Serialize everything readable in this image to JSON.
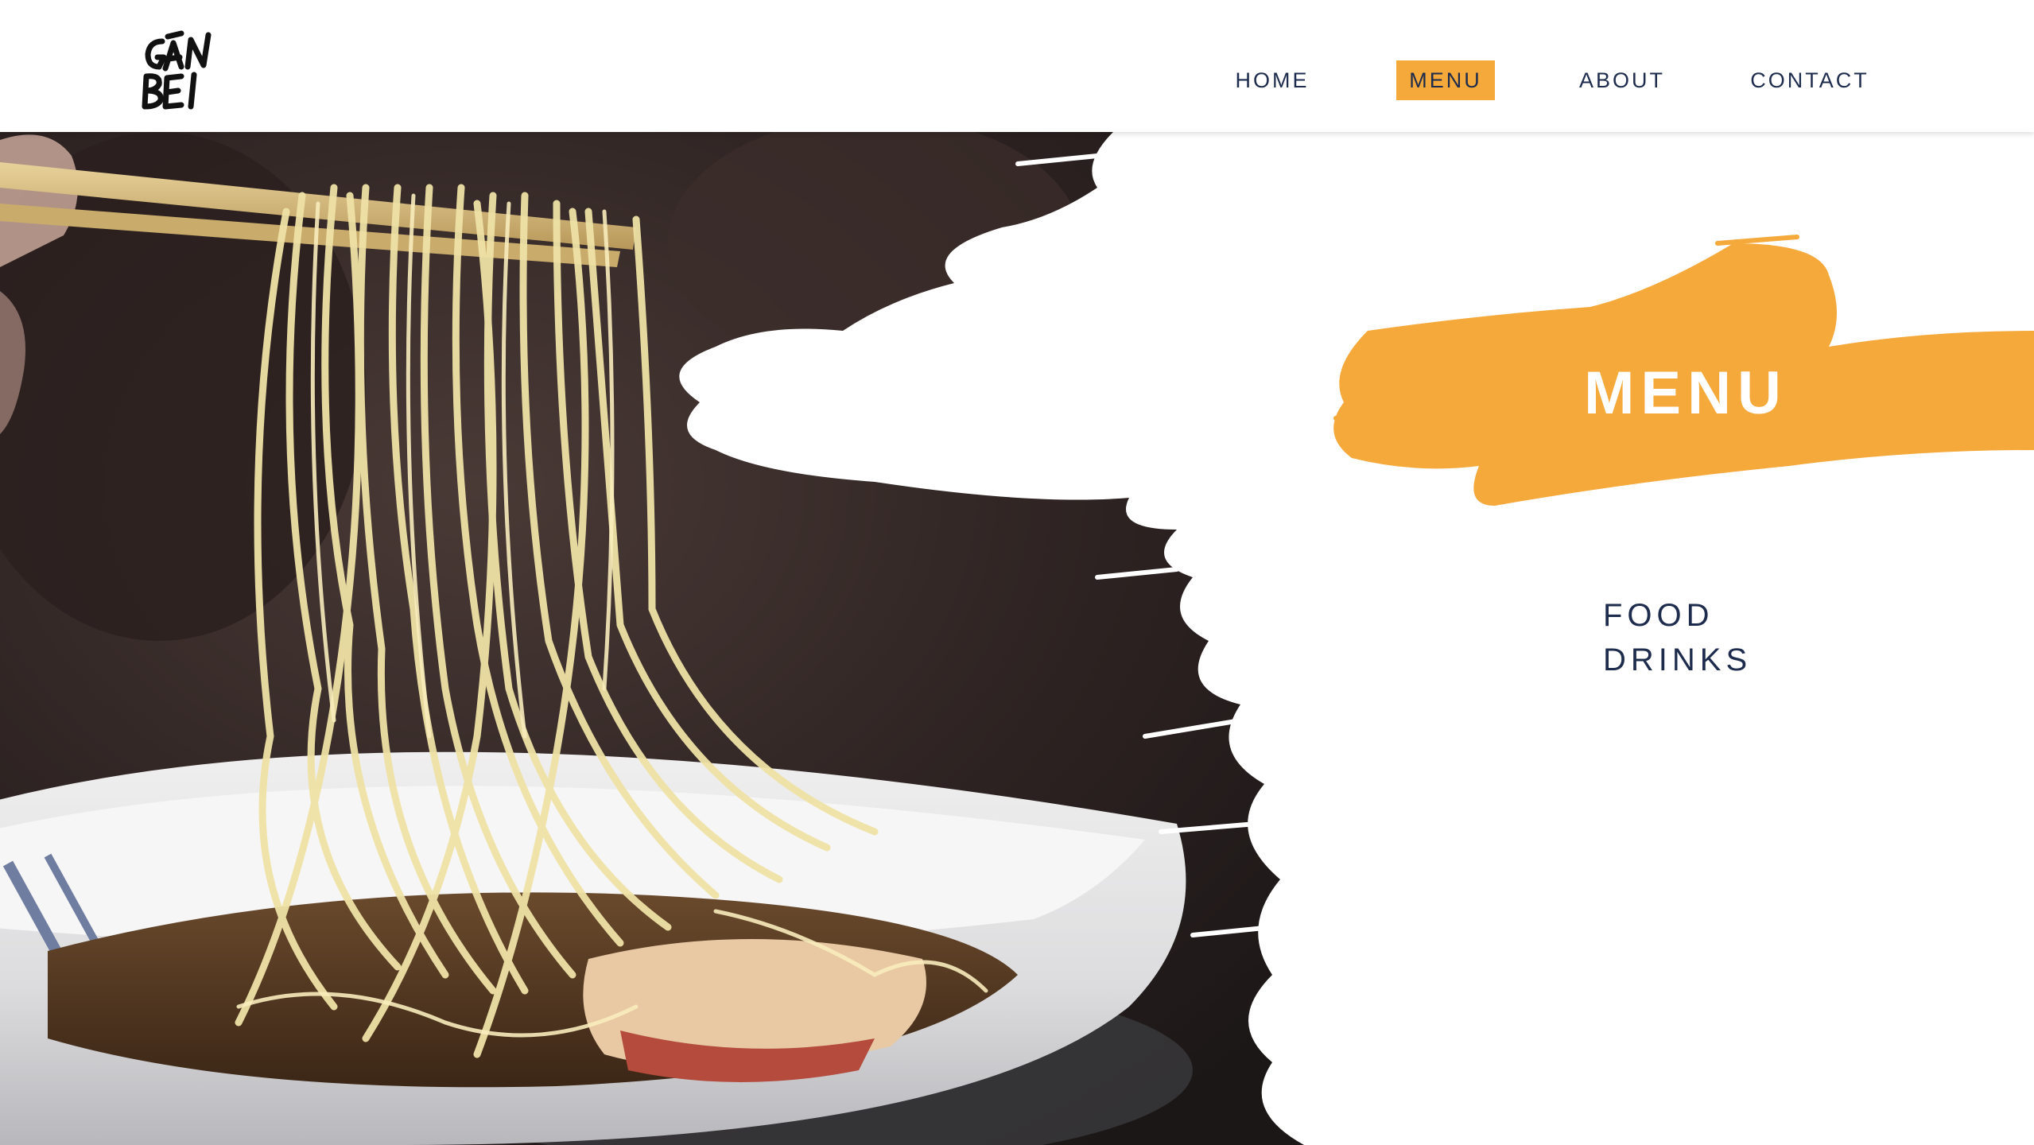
{
  "brand": {
    "logo_icon": "ganbei-brush-logo",
    "logo_text": "GĀN BEI"
  },
  "nav": {
    "items": [
      {
        "label": "HOME",
        "active": false
      },
      {
        "label": "MENU",
        "active": true
      },
      {
        "label": "ABOUT",
        "active": false
      },
      {
        "label": "CONTACT",
        "active": false
      }
    ]
  },
  "hero": {
    "image": "ramen-noodles-chopsticks-photo"
  },
  "section": {
    "title": "MENU",
    "links": [
      {
        "label": "FOOD"
      },
      {
        "label": "DRINKS"
      }
    ]
  },
  "colors": {
    "accent": "#f4a93a",
    "navy": "#1d2b4d",
    "background": "#ffffff"
  }
}
